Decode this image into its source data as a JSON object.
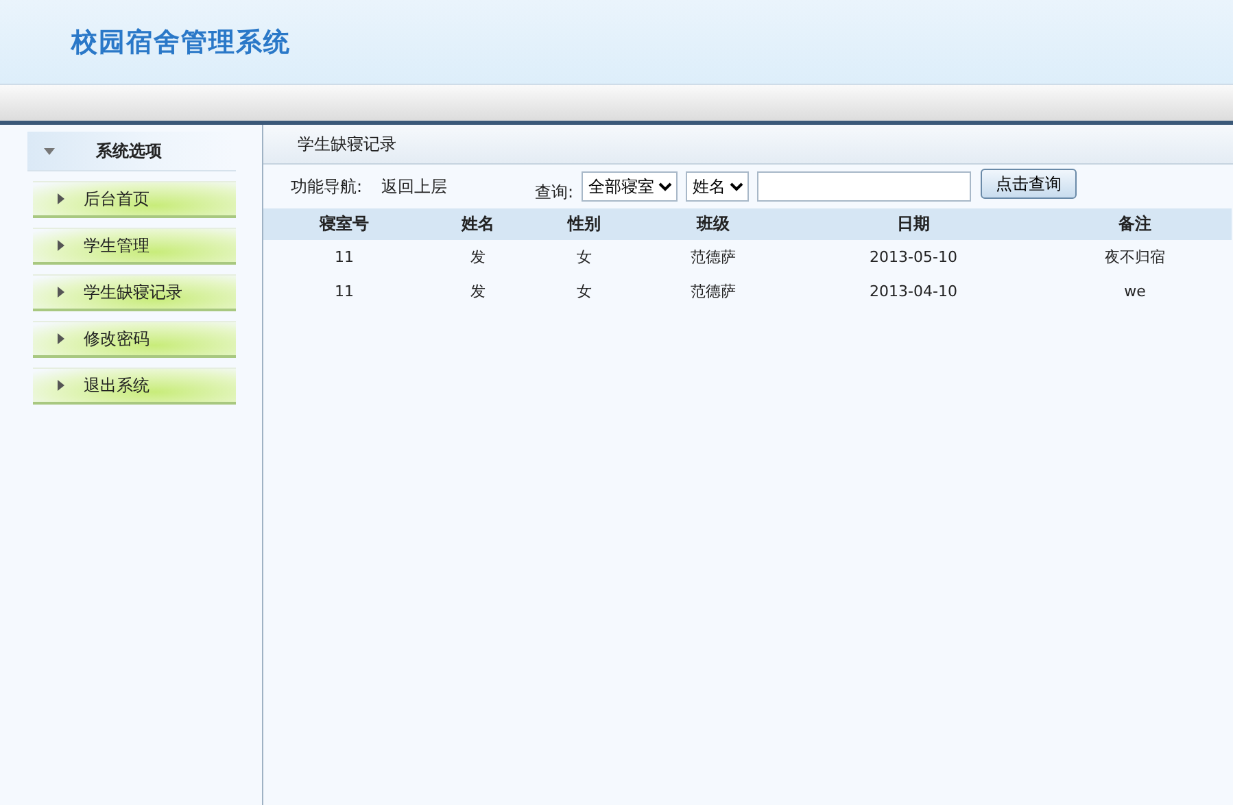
{
  "header": {
    "title": "校园宿舍管理系统"
  },
  "sidebar": {
    "heading": "系统选项",
    "items": [
      {
        "label": "后台首页"
      },
      {
        "label": "学生管理"
      },
      {
        "label": "学生缺寝记录"
      },
      {
        "label": "修改密码"
      },
      {
        "label": "退出系统"
      }
    ]
  },
  "main": {
    "title": "学生缺寝记录",
    "nav_label": "功能导航:",
    "nav_link": "返回上层",
    "query_label": "查询:",
    "dorm_select": "全部寝室",
    "field_select": "姓名",
    "search_button": "点击查询"
  },
  "table": {
    "columns": [
      "寝室号",
      "姓名",
      "性别",
      "班级",
      "日期",
      "备注"
    ],
    "rows": [
      [
        "11",
        "发",
        "女",
        "范德萨",
        "2013-05-10",
        "夜不归宿"
      ],
      [
        "11",
        "发",
        "女",
        "范德萨",
        "2013-04-10",
        "we"
      ]
    ]
  }
}
